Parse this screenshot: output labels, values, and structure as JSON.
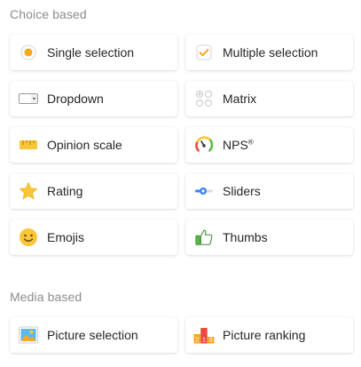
{
  "sections": {
    "choice": {
      "title": "Choice based",
      "items": [
        {
          "label": "Single selection",
          "icon": "radio-icon"
        },
        {
          "label": "Multiple selection",
          "icon": "checkbox-icon"
        },
        {
          "label": "Dropdown",
          "icon": "dropdown-icon"
        },
        {
          "label": "Matrix",
          "icon": "matrix-icon"
        },
        {
          "label": "Opinion scale",
          "icon": "ruler-icon"
        },
        {
          "label": "NPS",
          "icon": "gauge-icon",
          "suffix": "®"
        },
        {
          "label": "Rating",
          "icon": "star-icon"
        },
        {
          "label": "Sliders",
          "icon": "slider-icon"
        },
        {
          "label": "Emojis",
          "icon": "emoji-icon"
        },
        {
          "label": "Thumbs",
          "icon": "thumbs-up-icon"
        }
      ]
    },
    "media": {
      "title": "Media based",
      "items": [
        {
          "label": "Picture selection",
          "icon": "picture-icon"
        },
        {
          "label": "Picture ranking",
          "icon": "ranking-icon",
          "icon_digits": [
            "2",
            "1",
            "3"
          ]
        }
      ]
    }
  },
  "colors": {
    "accent_orange": "#f7a823",
    "yellow": "#f9c63a",
    "blue": "#3b82f6",
    "green": "#58b947",
    "section_title": "#8c8c8c",
    "label": "#262627"
  }
}
